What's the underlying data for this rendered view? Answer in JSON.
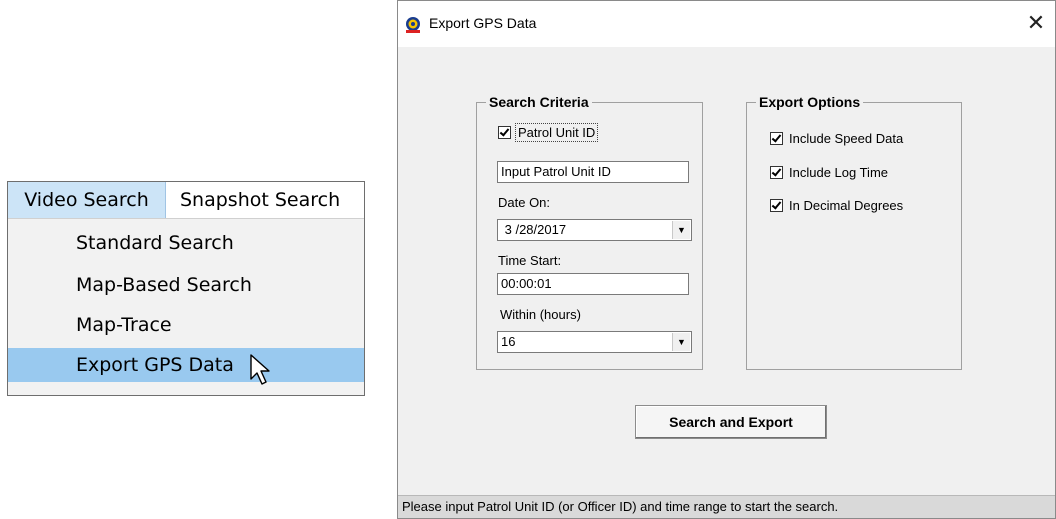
{
  "menu": {
    "bar_items": [
      "Video Search",
      "Snapshot Search"
    ],
    "items": [
      "Standard Search",
      "Map-Based Search",
      "Map-Trace",
      "Export GPS Data"
    ],
    "highlighted_item": "Export GPS Data"
  },
  "dialog": {
    "title": "Export GPS Data",
    "close_glyph": "✕",
    "search_criteria": {
      "legend": "Search Criteria",
      "patrol_unit_checkbox_label": "Patrol Unit ID",
      "patrol_unit_checked": true,
      "patrol_unit_input_value": "Input Patrol Unit ID",
      "date_on_label": "Date On:",
      "date_value": " 3 /28/2017",
      "time_start_label": "Time Start:",
      "time_start_value": "00:00:01",
      "within_label": "Within (hours)",
      "within_value": "16"
    },
    "export_options": {
      "legend": "Export Options",
      "options": [
        {
          "label": "Include Speed Data",
          "checked": true
        },
        {
          "label": "Include Log Time",
          "checked": true
        },
        {
          "label": "In Decimal Degrees",
          "checked": true
        }
      ]
    },
    "action_button": "Search and Export",
    "status_text": "Please input Patrol Unit ID (or Officer ID) and time range to start the search."
  },
  "colors": {
    "menu_highlight": "#99c9ef",
    "menu_bar_active": "#cce4f7",
    "dialog_bg": "#f0f0f0",
    "status_bg": "#d9d9d9"
  }
}
